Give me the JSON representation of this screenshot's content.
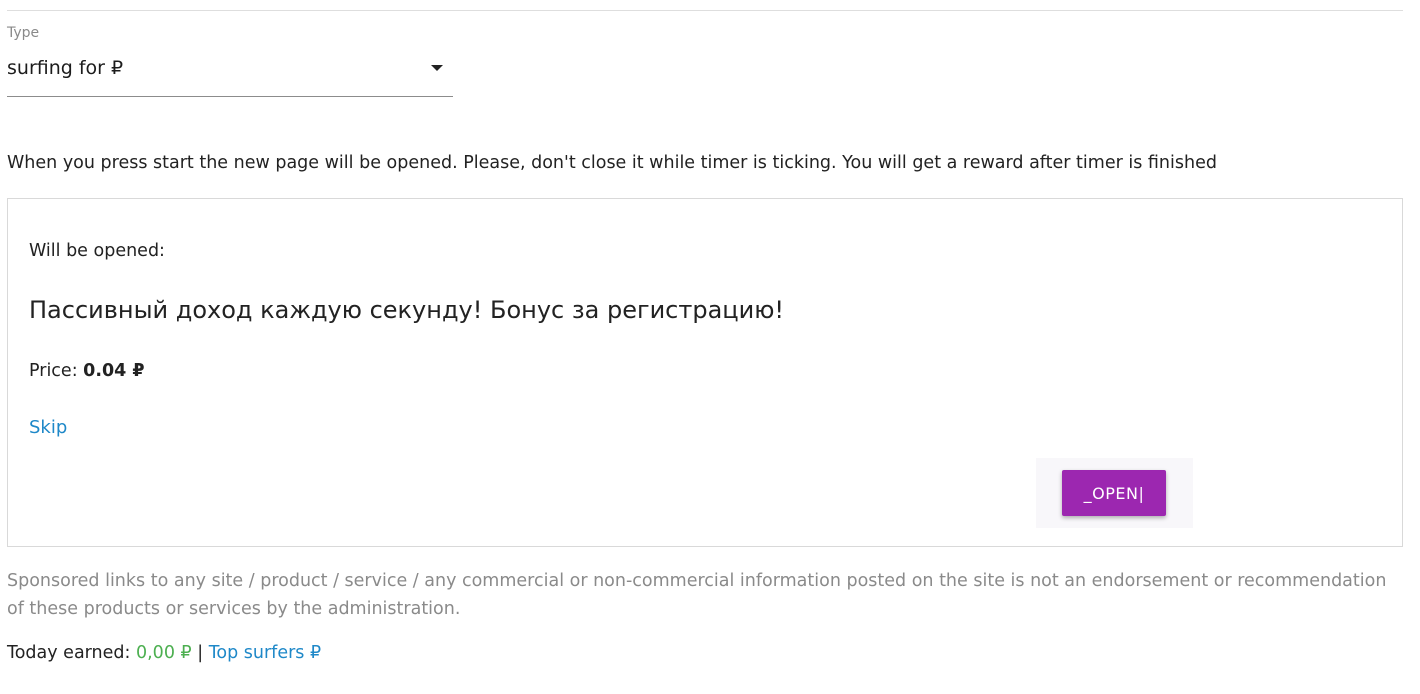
{
  "type_field": {
    "label": "Type",
    "value": "surfing for ₽"
  },
  "instructions": "When you press start the new page will be opened. Please, don't close it while timer is ticking. You will get a reward after timer is finished",
  "card": {
    "will_open_label": "Will be opened:",
    "ad_title": "Пассивный доход каждую секунду! Бонус за регистрацию!",
    "price_label": "Price: ",
    "price_value": "0.04 ₽",
    "skip_label": "Skip",
    "open_button_label": "_OPEN|"
  },
  "disclaimer": "Sponsored links to any site / product / service / any commercial or non-commercial information posted on the site is not an endorsement or recommendation of these products or services by the administration.",
  "footer": {
    "today_earned_label": "Today earned: ",
    "today_earned_value": "0,00 ₽",
    "separator": " | ",
    "top_surfers_label": "Top surfers ₽"
  },
  "colors": {
    "accent_button": "#9c27b0",
    "link": "#1e88c8",
    "earned": "#4caf50",
    "muted_text": "#8a8a8a"
  },
  "icons": {
    "dropdown": "chevron-down-icon"
  }
}
